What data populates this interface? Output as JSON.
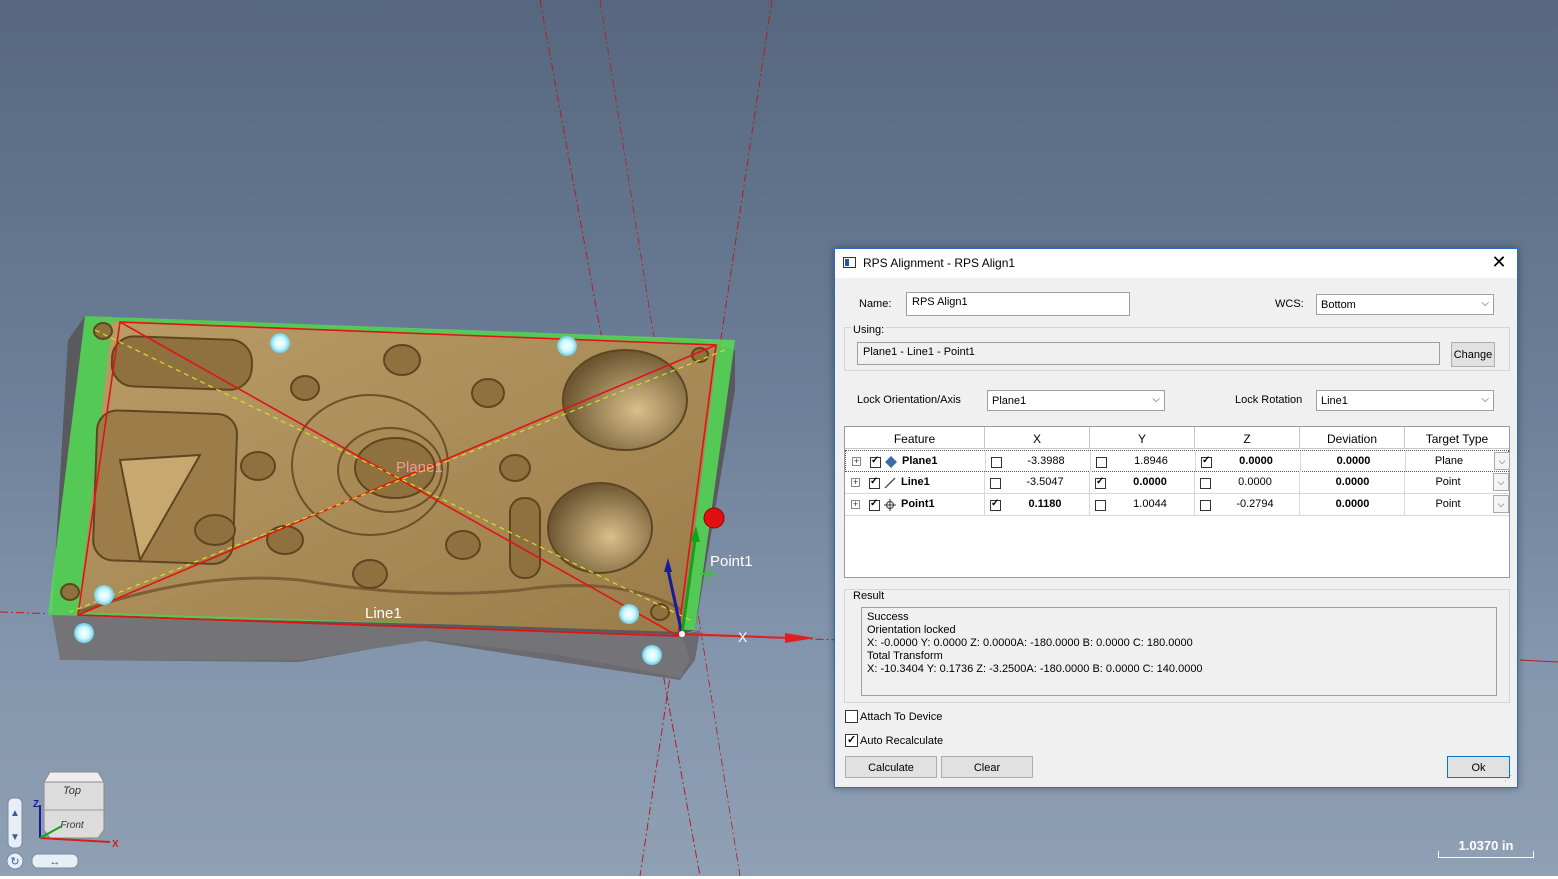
{
  "viewport": {
    "labels": {
      "plane": "Plane1",
      "line": "Line1",
      "point": "Point1",
      "axis_x": "X"
    },
    "scale": "1.0370 in",
    "viewcube": {
      "top": "Top",
      "front": "Front",
      "axis_z": "Z",
      "axis_x": "X"
    },
    "colors": {
      "part": "#a98b58",
      "plane_outline": "#e01414",
      "fit_region": "#4cd44c",
      "target_point": "#bff3ff",
      "selected_point": "#e01010"
    }
  },
  "dialog": {
    "title": "RPS Alignment - RPS Align1",
    "name_label": "Name:",
    "name_value": "RPS Align1",
    "wcs_label": "WCS:",
    "wcs_value": "Bottom",
    "using_label": "Using:",
    "using_value": "Plane1 - Line1 - Point1",
    "change_label": "Change",
    "lock_orientation_label": "Lock Orientation/Axis",
    "lock_orientation_value": "Plane1",
    "lock_rotation_label": "Lock Rotation",
    "lock_rotation_value": "Line1",
    "columns": [
      "Feature",
      "X",
      "Y",
      "Z",
      "Deviation",
      "Target Type"
    ],
    "rows": [
      {
        "feature": "Plane1",
        "icon": "plane-icon",
        "x": "-3.3988",
        "x_locked": false,
        "y": "1.8946",
        "y_locked": false,
        "z": "0.0000",
        "z_locked": true,
        "deviation": "0.0000",
        "target_type": "Plane"
      },
      {
        "feature": "Line1",
        "icon": "line-icon",
        "x": "-3.5047",
        "x_locked": false,
        "y": "0.0000",
        "y_locked": true,
        "z": "0.0000",
        "z_locked": false,
        "deviation": "0.0000",
        "target_type": "Point"
      },
      {
        "feature": "Point1",
        "icon": "point-icon",
        "x": "0.1180",
        "x_locked": true,
        "y": "1.0044",
        "y_locked": false,
        "z": "-0.2794",
        "z_locked": false,
        "deviation": "0.0000",
        "target_type": "Point"
      }
    ],
    "result_label": "Result",
    "result_lines": [
      "Success",
      "Orientation locked",
      "X: -0.0000 Y: 0.0000 Z: 0.0000A: -180.0000 B: 0.0000 C: 180.0000",
      "Total Transform",
      "X: -10.3404 Y: 0.1736 Z: -3.2500A: -180.0000 B: 0.0000 C: 140.0000"
    ],
    "attach_label": "Attach To Device",
    "attach_checked": false,
    "auto_recalc_label": "Auto Recalculate",
    "auto_recalc_checked": true,
    "calculate_label": "Calculate",
    "clear_label": "Clear",
    "ok_label": "Ok",
    "close_glyph": "✕"
  }
}
